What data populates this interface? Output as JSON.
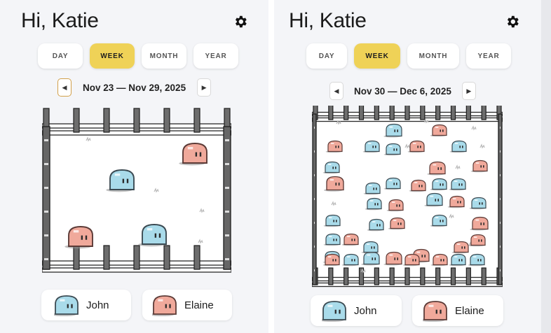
{
  "colors": {
    "accent": "#efd257",
    "blue_blob": "#a9dbea",
    "pink_blob": "#f0a99b",
    "fence": "#333333"
  },
  "panels": [
    {
      "greeting": "Hi, Katie",
      "settings_icon": "gear-icon",
      "tabs": [
        {
          "label": "DAY",
          "active": false
        },
        {
          "label": "WEEK",
          "active": true
        },
        {
          "label": "MONTH",
          "active": false
        },
        {
          "label": "YEAR",
          "active": false
        }
      ],
      "prev_icon": "◀",
      "next_icon": "▶",
      "date_range": "Nov 23 — Nov 29, 2025",
      "blob_counts": {
        "blue": 2,
        "pink": 2
      },
      "legend": [
        {
          "name": "John",
          "color": "blue"
        },
        {
          "name": "Elaine",
          "color": "pink"
        }
      ]
    },
    {
      "greeting": "Hi, Katie",
      "settings_icon": "gear-icon",
      "tabs": [
        {
          "label": "DAY",
          "active": false
        },
        {
          "label": "WEEK",
          "active": true
        },
        {
          "label": "MONTH",
          "active": false
        },
        {
          "label": "YEAR",
          "active": false
        }
      ],
      "prev_icon": "◀",
      "next_icon": "▶",
      "date_range": "Nov 30 — Dec 6, 2025",
      "blob_counts": {
        "blue": 23,
        "pink": 18
      },
      "legend": [
        {
          "name": "John",
          "color": "blue"
        },
        {
          "name": "Elaine",
          "color": "pink"
        }
      ]
    }
  ]
}
